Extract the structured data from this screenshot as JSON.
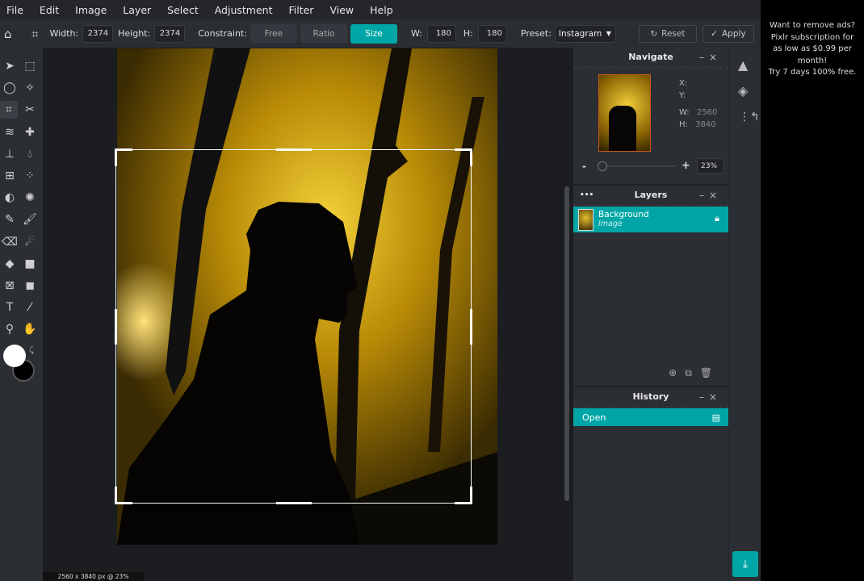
{
  "menu": [
    "File",
    "Edit",
    "Image",
    "Layer",
    "Select",
    "Adjustment",
    "Filter",
    "View",
    "Help"
  ],
  "toolbar": {
    "width_label": "Width:",
    "width_value": "2374",
    "height_label": "Height:",
    "height_value": "2374",
    "constraint_label": "Constraint:",
    "constraint_options": [
      "Free",
      "Ratio",
      "Size"
    ],
    "constraint_selected": "Size",
    "w_label": "W:",
    "w_value": "180",
    "h_label": "H:",
    "h_value": "180",
    "preset_label": "Preset:",
    "preset_value": "Instagram",
    "reset_label": "Reset",
    "apply_label": "Apply"
  },
  "tools": [
    "move",
    "marquee",
    "lasso",
    "wand",
    "crop",
    "cut",
    "liquify",
    "heal",
    "clone",
    "blur",
    "grid",
    "spot",
    "dodge",
    "sponge",
    "pen",
    "brush",
    "eraser",
    "smudge",
    "fill",
    "gradient",
    "frame",
    "shape",
    "text",
    "eyedropper",
    "zoom",
    "hand"
  ],
  "colors": {
    "foreground": "#ffffff",
    "background": "#000000",
    "accent": "#00a6a6"
  },
  "status": "2560 x 3840 px @ 23%",
  "navigate": {
    "title": "Navigate",
    "x_label": "X:",
    "y_label": "Y:",
    "w_label": "W:",
    "w_value": "2560",
    "h_label": "H:",
    "h_value": "3840",
    "zoom_minus": "-",
    "zoom_plus": "+",
    "zoom_value": "23%"
  },
  "layers": {
    "title": "Layers",
    "more": "•••",
    "items": [
      {
        "name": "Background",
        "type": "Image",
        "locked": true
      }
    ]
  },
  "history": {
    "title": "History",
    "items": [
      "Open"
    ]
  },
  "ad": {
    "lines": [
      "Want to remove ads?",
      "Pixlr subscription for",
      "as low as $0.99 per",
      "month!",
      "Try 7 days 100% free."
    ]
  }
}
